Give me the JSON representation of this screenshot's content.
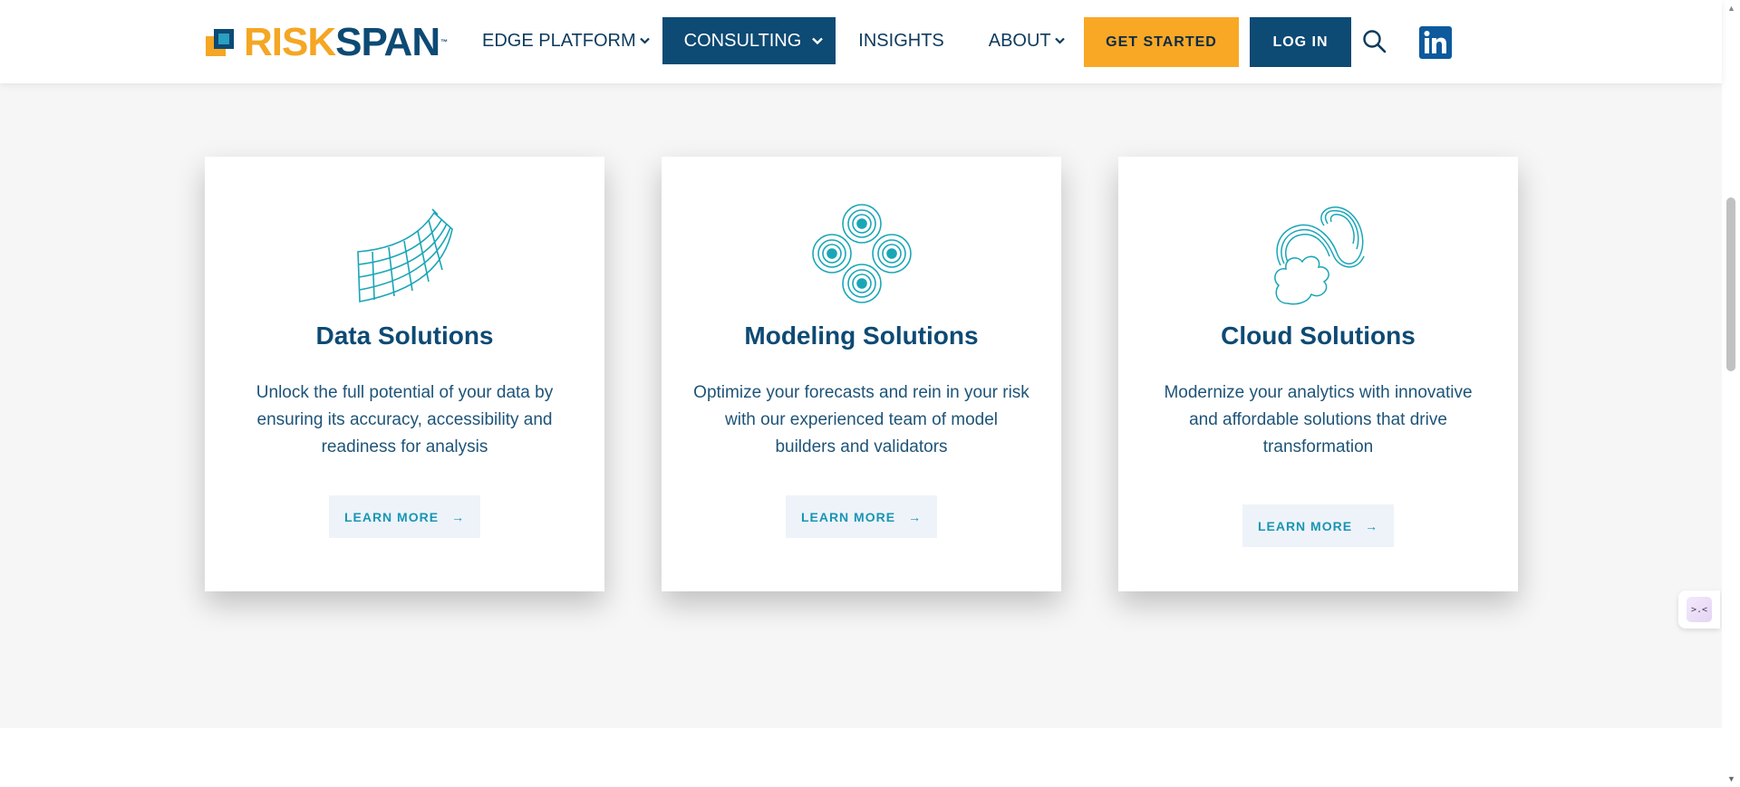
{
  "header": {
    "logo_risk": "RISK",
    "logo_span": "SPAN",
    "logo_tm": "™",
    "nav": {
      "edge_platform": "EDGE PLATFORM",
      "consulting": "CONSULTING",
      "insights": "INSIGHTS",
      "about": "ABOUT"
    },
    "get_started": "GET STARTED",
    "log_in": "LOG IN",
    "icons": [
      "search-icon",
      "linkedin-icon",
      "chevron-down-icon"
    ]
  },
  "cards": [
    {
      "icon": "data-grid-icon",
      "title": "Data Solutions",
      "text": "Unlock the full potential of your data by ensuring its accuracy, accessibility and readiness for analysis",
      "button": "LEARN MORE",
      "arrow": "→"
    },
    {
      "icon": "modeling-circles-icon",
      "title": "Modeling Solutions",
      "text": "Optimize your forecasts and rein in your risk with our experienced team of model builders and validators",
      "button": "LEARN MORE",
      "arrow": "→"
    },
    {
      "icon": "cloud-spiral-icon",
      "title": "Cloud Solutions",
      "text": "Modernize your analytics with innovative and affordable solutions that drive transformation",
      "button": "LEARN MORE",
      "arrow": "→"
    }
  ],
  "side_widget": {
    "label": ">.<"
  },
  "colors": {
    "brand_navy": "#0d4a74",
    "brand_orange": "#f5a623",
    "accent_teal": "#1896b3",
    "background": "#f6f6f6"
  }
}
